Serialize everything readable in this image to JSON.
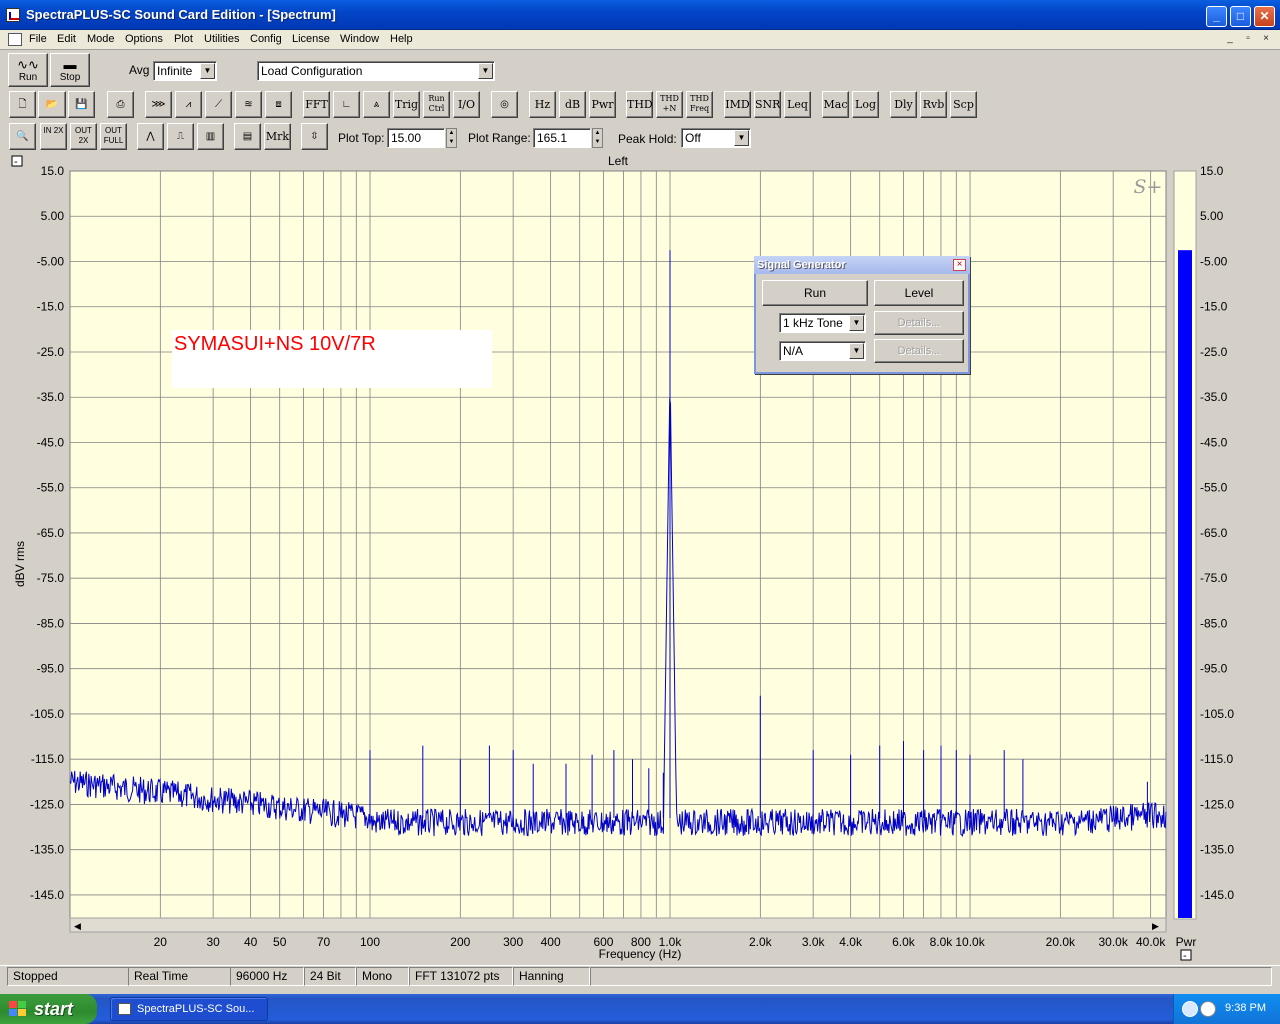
{
  "window": {
    "title": "SpectraPLUS-SC Sound Card Edition - [Spectrum]",
    "minimize": "_",
    "maximize": "□",
    "close": "✕"
  },
  "menu": [
    "File",
    "Edit",
    "Mode",
    "Options",
    "Plot",
    "Utilities",
    "Config",
    "License",
    "Window",
    "Help"
  ],
  "mdi_controls": {
    "minimize": "_",
    "restore": "▫",
    "close": "×"
  },
  "toolbar1": {
    "run_label": "Run",
    "stop_label": "Stop",
    "avg_label": "Avg",
    "avg_value": "Infinite",
    "config_value": "Load Configuration"
  },
  "toolbar2": {
    "buttons": [
      "FFT",
      "Trig",
      "Run Ctrl",
      "I/O",
      "Hz",
      "dB",
      "Pwr",
      "THD",
      "THD +N",
      "THD Freq",
      "IMD",
      "SNR",
      "Leq",
      "Mac",
      "Log",
      "Dly",
      "Rvb",
      "Scp"
    ]
  },
  "toolbar3": {
    "zoom_in": "IN 2X",
    "zoom_out": "OUT 2X",
    "zoom_full": "OUT FULL",
    "marker": "Mrk",
    "plot_top_label": "Plot Top:",
    "plot_top_value": "15.00",
    "plot_range_label": "Plot Range:",
    "plot_range_value": "165.1",
    "peak_hold_label": "Peak Hold:",
    "peak_hold_value": "Off"
  },
  "plot": {
    "channel_label": "Left",
    "watermark": "S+",
    "annotation": "SYMASUI+NS 10V/7R",
    "collapse_toggle": "-",
    "meter_label": "Pwr",
    "meter_level_db": -2.5
  },
  "chart_data": {
    "type": "line",
    "title": "Left",
    "xlabel": "Frequency (Hz)",
    "ylabel": "dBV rms",
    "x_scale": "log",
    "xlim": [
      10,
      45000
    ],
    "ylim": [
      -150.1,
      15.0
    ],
    "y_ticks": [
      "15.0",
      "5.00",
      "-5.00",
      "-15.0",
      "-25.0",
      "-35.0",
      "-45.0",
      "-55.0",
      "-65.0",
      "-75.0",
      "-85.0",
      "-95.0",
      "-105.0",
      "-115.0",
      "-125.0",
      "-135.0",
      "-145.0"
    ],
    "x_ticks": [
      {
        "f": 20,
        "label": "20"
      },
      {
        "f": 30,
        "label": "30"
      },
      {
        "f": 40,
        "label": "40"
      },
      {
        "f": 50,
        "label": "50"
      },
      {
        "f": 70,
        "label": "70"
      },
      {
        "f": 100,
        "label": "100"
      },
      {
        "f": 200,
        "label": "200"
      },
      {
        "f": 300,
        "label": "300"
      },
      {
        "f": 400,
        "label": "400"
      },
      {
        "f": 600,
        "label": "600"
      },
      {
        "f": 800,
        "label": "800"
      },
      {
        "f": 1000,
        "label": "1.0k"
      },
      {
        "f": 2000,
        "label": "2.0k"
      },
      {
        "f": 3000,
        "label": "3.0k"
      },
      {
        "f": 4000,
        "label": "4.0k"
      },
      {
        "f": 6000,
        "label": "6.0k"
      },
      {
        "f": 8000,
        "label": "8.0k"
      },
      {
        "f": 10000,
        "label": "10.0k"
      },
      {
        "f": 20000,
        "label": "20.0k"
      },
      {
        "f": 30000,
        "label": "30.0k"
      },
      {
        "f": 40000,
        "label": "40.0k"
      }
    ],
    "noise_floor_db": -128,
    "series": [
      {
        "color": "#0000c8",
        "peaks": [
          {
            "f": 1000,
            "db": -2.5
          },
          {
            "f": 2000,
            "db": -101
          },
          {
            "f": 3000,
            "db": -113
          },
          {
            "f": 4000,
            "db": -114
          },
          {
            "f": 5000,
            "db": -112
          },
          {
            "f": 6000,
            "db": -111
          },
          {
            "f": 7000,
            "db": -113
          },
          {
            "f": 8000,
            "db": -112
          },
          {
            "f": 9000,
            "db": -113
          },
          {
            "f": 10000,
            "db": -114
          },
          {
            "f": 13000,
            "db": -113
          },
          {
            "f": 15000,
            "db": -115
          },
          {
            "f": 100,
            "db": -113
          },
          {
            "f": 150,
            "db": -112
          },
          {
            "f": 200,
            "db": -115
          },
          {
            "f": 250,
            "db": -112
          },
          {
            "f": 300,
            "db": -113
          },
          {
            "f": 350,
            "db": -116
          },
          {
            "f": 450,
            "db": -116
          },
          {
            "f": 550,
            "db": -114
          },
          {
            "f": 650,
            "db": -113
          },
          {
            "f": 750,
            "db": -115
          },
          {
            "f": 850,
            "db": -117
          },
          {
            "f": 950,
            "db": -118
          },
          {
            "f": 39000,
            "db": -120
          }
        ]
      }
    ]
  },
  "signal_generator": {
    "title": "Signal Generator",
    "close": "×",
    "run_label": "Run",
    "level_label": "Level",
    "tone_value": "1 kHz Tone",
    "details1_label": "Details...",
    "mode_value": "N/A",
    "details2_label": "Details..."
  },
  "status": [
    "Stopped",
    "Real Time",
    "96000 Hz",
    "24 Bit",
    "Mono",
    "FFT 131072 pts",
    "Hanning"
  ],
  "taskbar": {
    "start_label": "start",
    "task_label": "SpectraPLUS-SC Sou...",
    "clock": "9:38 PM"
  },
  "colors": {
    "plot_bg": "#ffffe0",
    "grid": "#808080",
    "trace": "#0000c8",
    "meter": "#0000ff",
    "annotation": "#ff0000"
  }
}
